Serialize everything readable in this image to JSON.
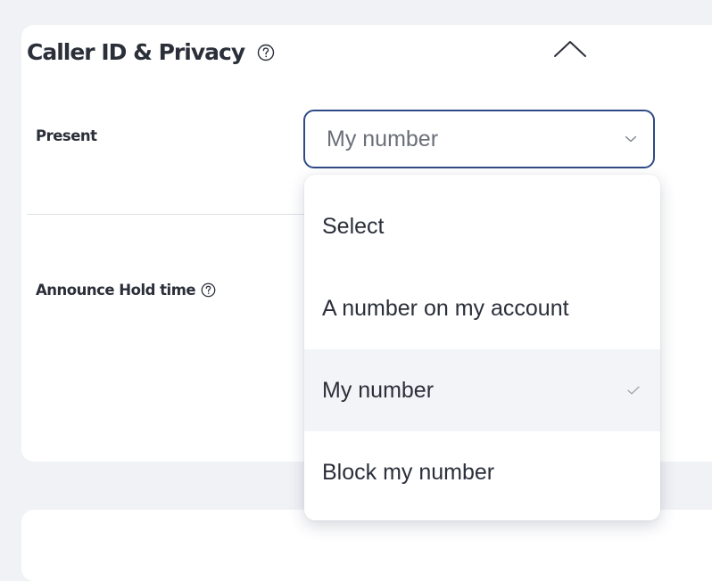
{
  "section": {
    "title": "Caller ID & Privacy"
  },
  "fields": {
    "present_label": "Present",
    "hold_label": "Announce Hold time"
  },
  "present_select": {
    "value": "My number",
    "options": [
      {
        "label": "Select"
      },
      {
        "label": "A number on my account"
      },
      {
        "label": "My number",
        "selected": true
      },
      {
        "label": "Block my number"
      }
    ]
  },
  "icons": {
    "help": "help-circle-icon",
    "collapse": "chevron-up-icon",
    "dropdown": "chevron-down-icon",
    "selected": "check-icon"
  },
  "colors": {
    "select_border": "#2f4a86",
    "page_background": "#f1f2f6",
    "selected_option_bg": "#f3f4f7"
  }
}
